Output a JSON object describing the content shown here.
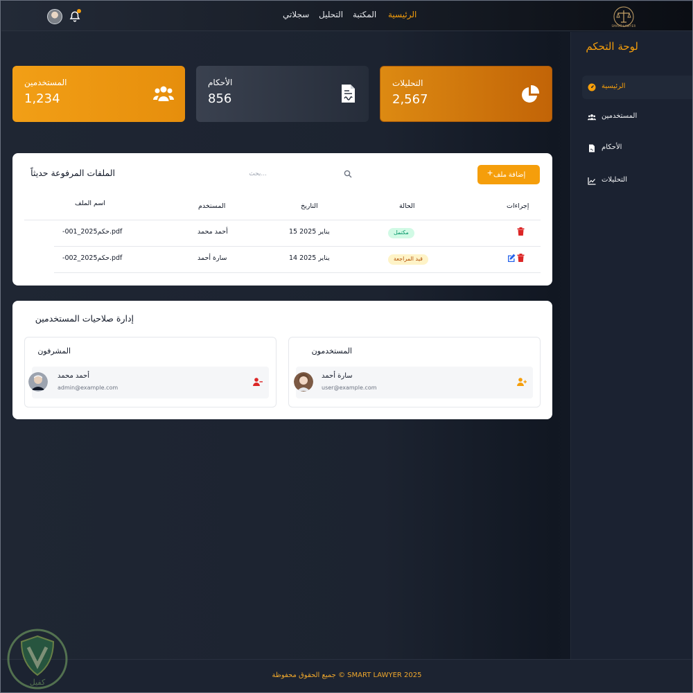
{
  "app": {
    "logo_text": "SMART LAWYER"
  },
  "topnav": {
    "items": [
      "الرئيسية",
      "المكتبة",
      "التحليل",
      "سجلاتي"
    ]
  },
  "sidebar": {
    "title": "لوحة التحكم",
    "items": [
      {
        "label": "الرئيسية",
        "icon": "dashboard-icon"
      },
      {
        "label": "المستخدمين",
        "icon": "users-icon"
      },
      {
        "label": "الأحكام",
        "icon": "document-icon"
      },
      {
        "label": "التحليلات",
        "icon": "chart-line-icon"
      }
    ]
  },
  "stats": [
    {
      "label": "المستخدمين",
      "value": "1,234",
      "icon": "users-icon"
    },
    {
      "label": "الأحكام",
      "value": "856",
      "icon": "document-icon"
    },
    {
      "label": "التحليلات",
      "value": "2,567",
      "icon": "pie-chart-icon"
    }
  ],
  "files": {
    "title": "الملفات المرفوعة حديثاً",
    "search_placeholder": "بحث...",
    "add_label": "إضافة ملف",
    "columns": {
      "file_name": "اسم الملف",
      "user": "المستخدم",
      "date": "التاريخ",
      "status": "الحالة",
      "actions": "إجراءات"
    },
    "rows": [
      {
        "file_name": "حكم-2025_001.pdf",
        "file_parts": [
          "-حكم",
          "2025",
          "001",
          ".pdf"
        ],
        "user": "أحمد محمد",
        "date": "15 يناير 2025",
        "date_day": "15 يناير",
        "date_year": "2025",
        "status": "مكتمل"
      },
      {
        "file_name": "حكم-2025_002.pdf",
        "file_parts": [
          "-حكم",
          "2025",
          "002",
          ".pdf"
        ],
        "user": "سارة أحمد",
        "date": "14 يناير 2025",
        "date_day": "14 يناير",
        "date_year": "2025",
        "status": "قيد المراجعة"
      }
    ]
  },
  "permissions": {
    "title": "إدارة صلاحيات المستخدمين",
    "admins": {
      "title": "المشرفون",
      "user": {
        "name": "أحمد محمد",
        "email": "admin@example.com"
      }
    },
    "users": {
      "title": "المستخدمون",
      "user": {
        "name": "سارة أحمد",
        "email": "user@example.com"
      }
    }
  },
  "footer": {
    "text": "جميع الحقوق محفوظة © SMART LAWYER 2025"
  },
  "watermark": {
    "text": "كفيل"
  },
  "colors": {
    "accent": "#f59e0b",
    "danger": "#dc2626",
    "edit": "#2563eb"
  }
}
